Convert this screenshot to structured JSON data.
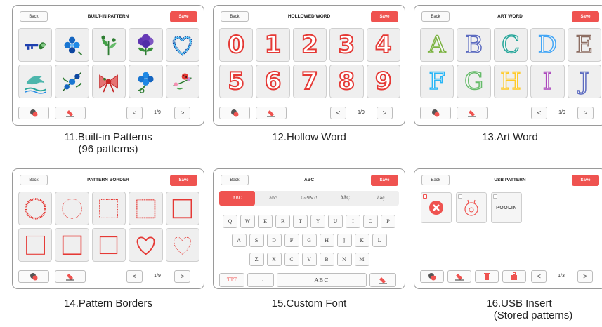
{
  "colors": {
    "accent": "#ef5350",
    "tile_bg": "#efefef",
    "hollow_red": "#e53935"
  },
  "common": {
    "back_label": "Back",
    "save_label": "Save",
    "prev_glyph": "<",
    "next_glyph": ">"
  },
  "panels": {
    "builtin": {
      "title": "BUILT-IN PATTERN",
      "page": "1/9",
      "caption_line1": "11.Built-in Patterns",
      "caption_line2": "(96 patterns)",
      "tiles": [
        "key-motif-icon",
        "blue-floral-icon",
        "green-plant-icon",
        "purple-flower-icon",
        "heart-wreath-icon",
        "dolphin-icon",
        "blue-branch-icon",
        "red-bow-icon",
        "blue-flower-icon",
        "ladybug-flowers-icon"
      ]
    },
    "hollow": {
      "title": "HOLLOWED WORD",
      "page": "1/9",
      "caption": "12.Hollow Word",
      "digits": [
        "0",
        "1",
        "2",
        "3",
        "4",
        "5",
        "6",
        "7",
        "8",
        "9"
      ]
    },
    "art": {
      "title": "ART WORD",
      "page": "1/9",
      "caption": "13.Art Word",
      "letters": [
        "A",
        "B",
        "C",
        "D",
        "E",
        "F",
        "G",
        "H",
        "I",
        "J"
      ]
    },
    "border": {
      "title": "PATTERN BORDER",
      "page": "1/9",
      "caption": "14.Pattern Borders",
      "tiles": [
        "circle-scallop-border-icon",
        "circle-dot-border-icon",
        "square-dotted-border-icon",
        "square-stitch-border-icon",
        "square-solid-border-icon",
        "square-thin-border-icon",
        "square-thick-border-icon",
        "square-wavy-border-icon",
        "heart-solid-border-icon",
        "heart-dotted-border-icon"
      ]
    },
    "font": {
      "title": "ABC",
      "caption": "15.Custom Font",
      "tabs": [
        "ABC",
        "abc",
        "0~9&?!",
        "ÀÂÇ",
        "àâç"
      ],
      "row1": [
        "Q",
        "W",
        "E",
        "R",
        "T",
        "Y",
        "U",
        "I",
        "O",
        "P"
      ],
      "row2": [
        "A",
        "S",
        "D",
        "F",
        "G",
        "H",
        "J",
        "K",
        "L"
      ],
      "row3": [
        "Z",
        "X",
        "C",
        "V",
        "B",
        "N",
        "M"
      ],
      "font_key": "TTT",
      "space_glyph": "⌴",
      "preview": "ABC"
    },
    "usb": {
      "title": "USB PATTERN",
      "page": "1/3",
      "caption_line1": "16.USB Insert",
      "caption_line2": "(Stored patterns)",
      "brand": "POOLIN"
    }
  }
}
